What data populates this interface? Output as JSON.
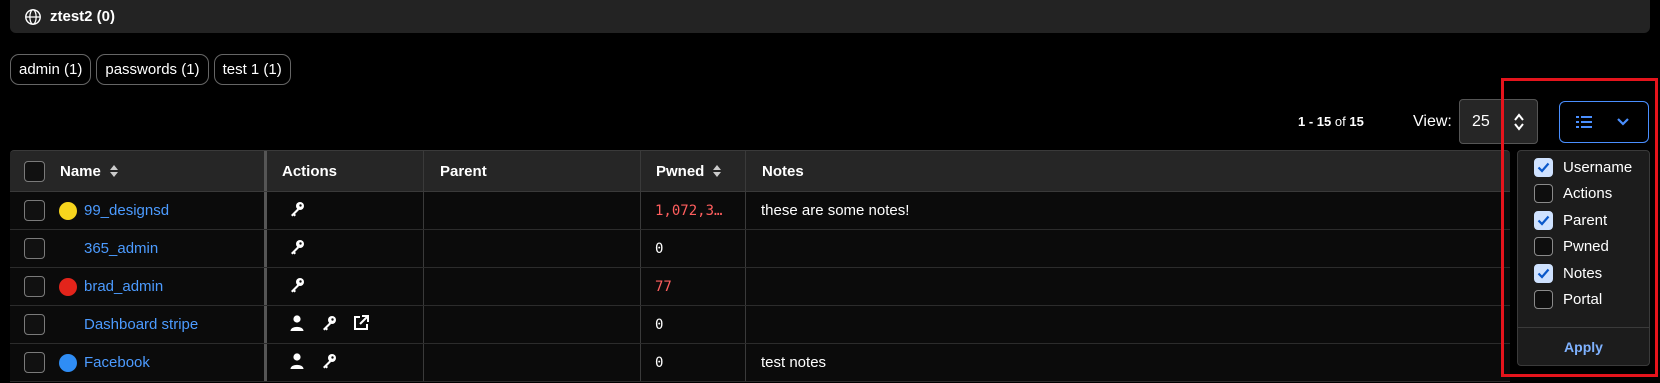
{
  "folder": {
    "title": "ztest2 (0)",
    "icon": "globe-icon"
  },
  "tags": [
    {
      "label": "admin (1)"
    },
    {
      "label": "passwords (1)"
    },
    {
      "label": "test 1 (1)"
    }
  ],
  "pager": {
    "start": "1",
    "sep": " - ",
    "end": "15",
    "of_word": " of ",
    "total": "15",
    "view_label": "View:",
    "view_value": "25"
  },
  "columns": {
    "name": "Name",
    "actions": "Actions",
    "parent": "Parent",
    "pwned": "Pwned",
    "notes": "Notes"
  },
  "rows": [
    {
      "name": "99_designsd",
      "dot": "#f7d51d",
      "actions": [
        "key-icon"
      ],
      "parent": "",
      "pwned": "1,072,3…",
      "pwned_status": "red",
      "notes": "these are some notes!"
    },
    {
      "name": "365_admin",
      "dot": "",
      "actions": [
        "key-icon"
      ],
      "parent": "",
      "pwned": "0",
      "pwned_status": "white",
      "notes": ""
    },
    {
      "name": "brad_admin",
      "dot": "#e3241b",
      "actions": [
        "key-icon"
      ],
      "parent": "",
      "pwned": "77",
      "pwned_status": "red",
      "notes": ""
    },
    {
      "name": "Dashboard stripe",
      "dot": "",
      "actions": [
        "user-icon",
        "key-icon",
        "external-link-icon"
      ],
      "parent": "",
      "pwned": "0",
      "pwned_status": "white",
      "notes": ""
    },
    {
      "name": "Facebook",
      "dot": "#2f8df5",
      "actions": [
        "user-icon",
        "key-icon"
      ],
      "parent": "",
      "pwned": "0",
      "pwned_status": "white",
      "notes": "test notes"
    }
  ],
  "column_menu": {
    "items": [
      {
        "label": "Username",
        "checked": true
      },
      {
        "label": "Actions",
        "checked": false
      },
      {
        "label": "Parent",
        "checked": true
      },
      {
        "label": "Pwned",
        "checked": false
      },
      {
        "label": "Notes",
        "checked": true
      },
      {
        "label": "Portal",
        "checked": false
      }
    ],
    "apply_label": "Apply"
  },
  "colors": {
    "link": "#4c9bff",
    "accent": "#4a8fff",
    "highlight_box": "#e5141c",
    "pwned_red": "#ff5e5e"
  }
}
